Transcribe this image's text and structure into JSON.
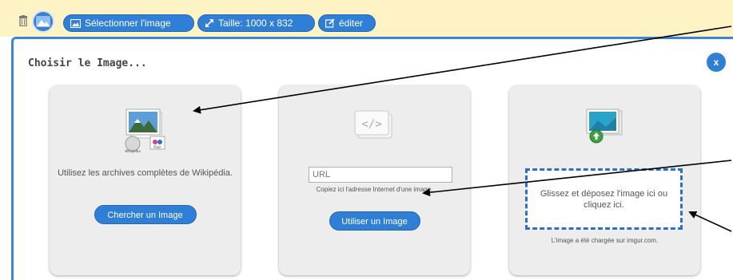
{
  "toolbar": {
    "select_label": "Sélectionner l'image",
    "size_label": "Taille: 1000 x 832",
    "edit_label": "éditer"
  },
  "dialog": {
    "title": "Choisir le Image...",
    "close_label": "x"
  },
  "cards": {
    "wiki": {
      "text": "Utilisez les archives complètes de Wikipédia.",
      "button": "Chercher un Image"
    },
    "url": {
      "placeholder": "URL",
      "help": "Copiez ici l'adresse Internet d'une image.",
      "button": "Utiliser un Image"
    },
    "upload": {
      "dropzone": "Glissez et déposez l'image ici ou cliquez ici.",
      "note": "L'image a été chargée sur imgur.com."
    }
  },
  "colors": {
    "toolbar_bg": "#fdf3c5",
    "accent": "#2f7fd6",
    "dialog_border": "#3b86d8",
    "card_bg": "#ededed"
  }
}
